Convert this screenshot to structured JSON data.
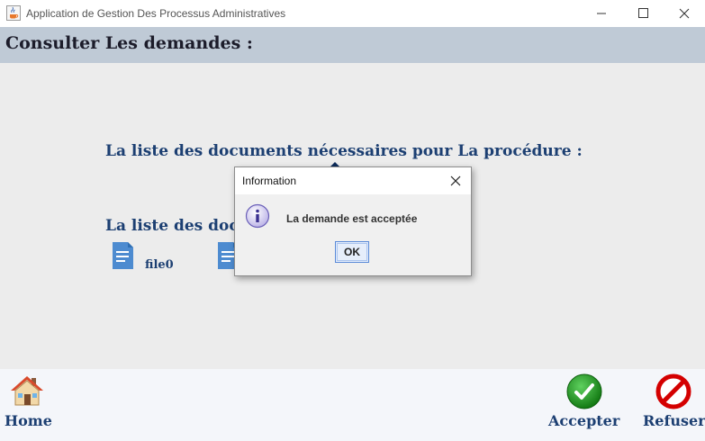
{
  "window": {
    "title": "Application de Gestion Des Processus Administratives",
    "icon": "java-cup-icon",
    "controls": [
      "minimize-icon",
      "maximize-icon",
      "close-icon"
    ]
  },
  "header": {
    "title": "Consulter Les demandes :"
  },
  "content": {
    "documents_heading": "La liste des documents nécessaires pour La procédure :",
    "uploaded_heading": "La liste des documents",
    "files": [
      {
        "name": "file0",
        "icon": "document-icon"
      },
      {
        "name": "",
        "icon": "document-icon"
      }
    ]
  },
  "footer": {
    "home_label": "Home",
    "accept_label": "Accepter",
    "refuse_label": "Refuser",
    "colors": {
      "accept": "#2e9a2e",
      "refuse": "#d40000",
      "home_roof": "#d94a2b"
    }
  },
  "dialog": {
    "title": "Information",
    "message": "La demande est acceptée",
    "ok_label": "OK",
    "icon": "info-icon"
  }
}
